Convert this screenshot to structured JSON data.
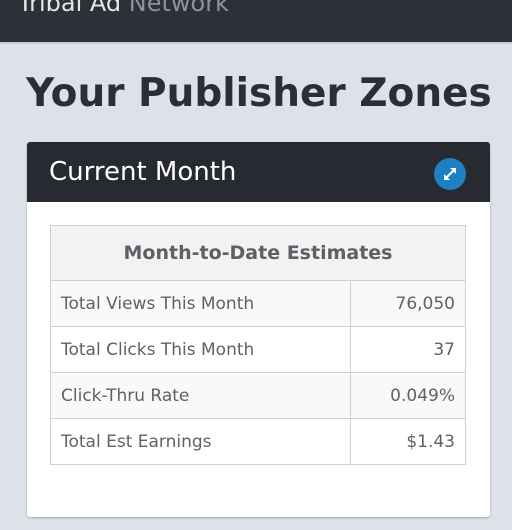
{
  "navbar": {
    "brand_strong": "Tribal Ad",
    "brand_light": "Network"
  },
  "page": {
    "title": "Your Publisher Zones"
  },
  "panel": {
    "title": "Current Month",
    "expand_icon": "expand-arrows-icon",
    "table": {
      "header": "Month-to-Date Estimates",
      "rows": [
        {
          "label": "Total Views This Month",
          "value": "76,050"
        },
        {
          "label": "Total Clicks This Month",
          "value": "37"
        },
        {
          "label": "Click-Thru Rate",
          "value": "0.049%"
        },
        {
          "label": "Total Est Earnings",
          "value": "$1.43"
        }
      ]
    }
  },
  "colors": {
    "background": "#dde2e9",
    "navbar": "#2c3037",
    "panel_header": "#272a30",
    "accent": "#1d80c3"
  }
}
